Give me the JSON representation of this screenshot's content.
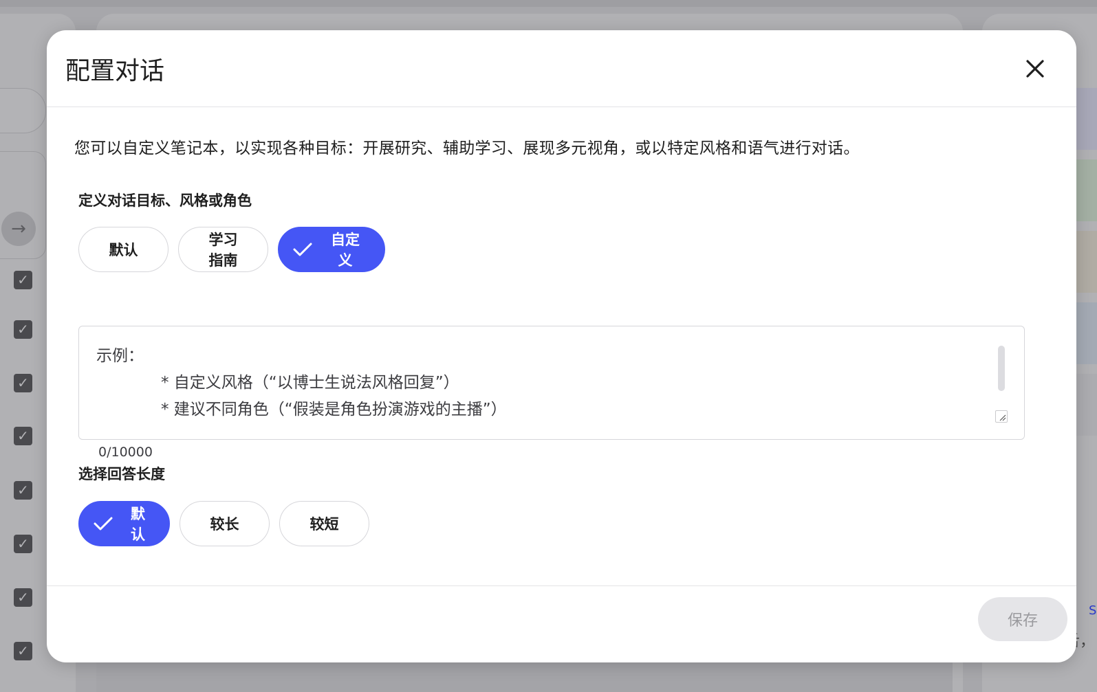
{
  "dialog": {
    "title": "配置对话",
    "description": "您可以自定义笔记本，以实现各种目标：开展研究、辅助学习、展现多元视角，或以特定风格和语气进行对话。",
    "goal_section": {
      "label": "定义对话目标、风格或角色",
      "options": [
        {
          "label": "默认",
          "selected": false
        },
        {
          "label": "学习指南",
          "selected": false
        },
        {
          "label": "自定义",
          "selected": true
        }
      ]
    },
    "custom_prompt": {
      "value": "",
      "placeholder_lines": [
        "示例：",
        "* 自定义风格（“以博士生说法风格回复”）",
        "* 建议不同角色（“假装是角色扮演游戏的主播”）"
      ],
      "char_count": "0/10000"
    },
    "length_section": {
      "label": "选择回答长度",
      "options": [
        {
          "label": "默认",
          "selected": true
        },
        {
          "label": "较长",
          "selected": false
        },
        {
          "label": "较短",
          "selected": false
        }
      ]
    },
    "save_label": "保存"
  },
  "background": {
    "right_link_fragment": "S",
    "right_text_fragment": "舌，"
  },
  "colors": {
    "accent": "#4556f5",
    "overlay": "#a7a7ab",
    "disabled_button_bg": "#e5e5e8",
    "disabled_button_text": "#9a9a9e"
  },
  "icons": {
    "close": "close-icon",
    "check": "check-icon",
    "arrow": "arrow-right-icon"
  }
}
